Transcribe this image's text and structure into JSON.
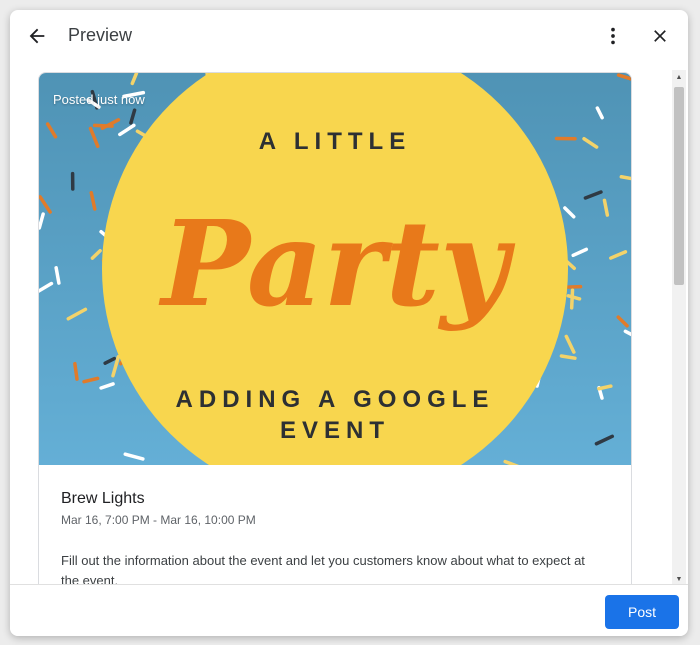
{
  "header": {
    "title": "Preview",
    "back_icon": "arrow-back-icon",
    "more_icon": "more-vert-icon",
    "close_icon": "close-icon"
  },
  "post": {
    "posted_label": "Posted just now",
    "image_text": {
      "line1": "A LITTLE",
      "script": "Party",
      "line2": "ADDING A GOOGLE",
      "line3": "EVENT"
    },
    "event_title": "Brew Lights",
    "event_date": "Mar 16, 7:00 PM - Mar 16, 10:00 PM",
    "description": "Fill out the information about the event and let you customers know about what to expect at the event."
  },
  "footer": {
    "post_label": "Post"
  },
  "colors": {
    "accent": "#1a73e8",
    "banner_bg": "#5ba4cc",
    "circle": "#f9d64f",
    "script_text": "#e8791a"
  }
}
